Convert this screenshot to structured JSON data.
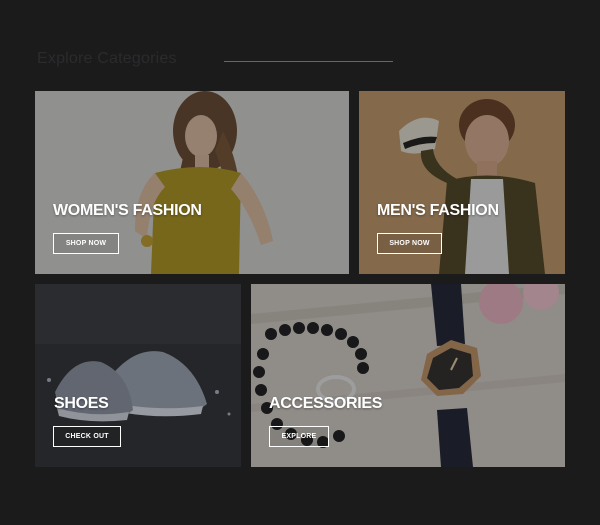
{
  "section": {
    "title": "Explore Categories"
  },
  "categories": [
    {
      "label": "WOMEN'S FASHION",
      "button": "SHOP NOW"
    },
    {
      "label": "MEN'S FASHION",
      "button": "SHOP NOW"
    },
    {
      "label": "SHOES",
      "button": "CHECK OUT"
    },
    {
      "label": "ACCESSORIES",
      "button": "EXPLORE"
    }
  ],
  "colors": {
    "background": "#1b1b1c",
    "accent_rule": "#2a7e8c",
    "title_text": "#2b2b2d",
    "label_text": "#ffffff"
  }
}
